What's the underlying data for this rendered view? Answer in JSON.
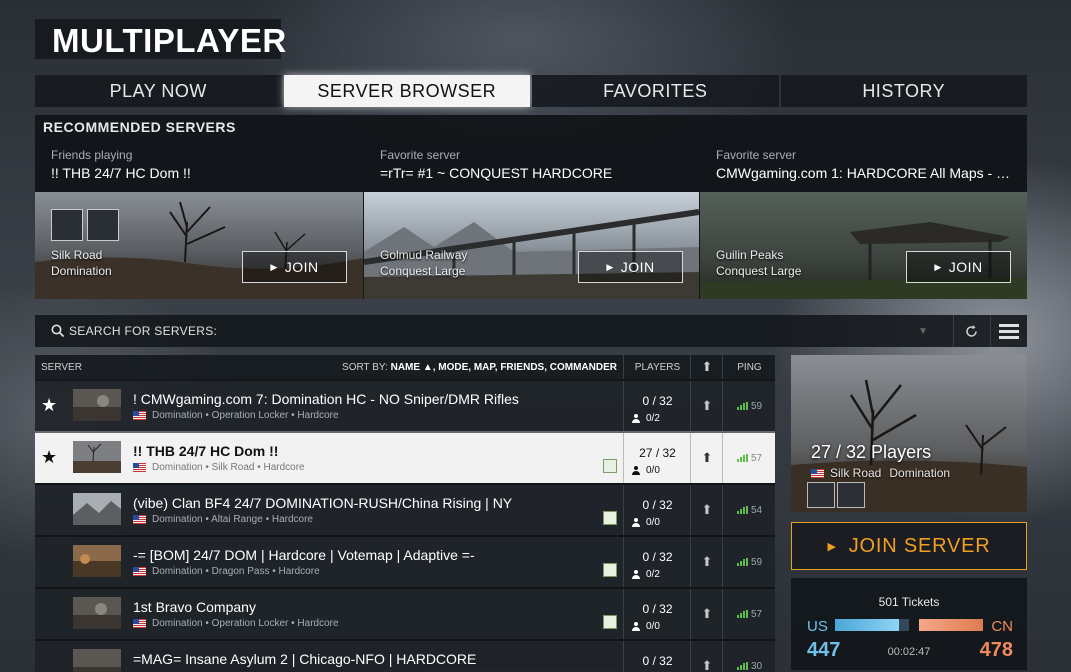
{
  "app": {
    "title": "MULTIPLAYER"
  },
  "tabs": [
    {
      "label": "PLAY NOW",
      "active": false
    },
    {
      "label": "SERVER BROWSER",
      "active": true
    },
    {
      "label": "FAVORITES",
      "active": false
    },
    {
      "label": "HISTORY",
      "active": false
    }
  ],
  "recommended": {
    "heading": "RECOMMENDED SERVERS",
    "cards": [
      {
        "kind": "Friends playing",
        "server": "!! THB 24/7 HC Dom !!",
        "map": "Silk Road",
        "mode": "Domination",
        "join": "JOIN"
      },
      {
        "kind": "Favorite server",
        "server": "=rTr= #1 ~ CONQUEST HARDCORE",
        "map": "Golmud Railway",
        "mode": "Conquest Large",
        "join": "JOIN"
      },
      {
        "kind": "Favorite server",
        "server": "CMWgaming.com 1: HARDCORE All Maps - …",
        "map": "Guilin Peaks",
        "mode": "Conquest Large",
        "join": "JOIN"
      }
    ]
  },
  "search": {
    "label": "SEARCH FOR SERVERS:",
    "icon": "search-icon",
    "refresh_icon": "refresh-icon",
    "menu_icon": "menu-icon"
  },
  "list": {
    "headers": {
      "server": "SERVER",
      "sort_prefix": "SORT BY:",
      "sort_name": "NAME ▲",
      "sort_rest": ", MODE, MAP, FRIENDS, COMMANDER",
      "players": "PLAYERS",
      "ping": "PING"
    },
    "rows": [
      {
        "star": "★",
        "name": "! CMWgaming.com 7: Domination HC - NO Sniper/DMR Rifles",
        "meta": "Domination • Operation Locker • Hardcore",
        "players": "0 / 32",
        "queue": "0/2",
        "ping": "59",
        "commander": false,
        "selected": false
      },
      {
        "star": "★",
        "name": "!! THB 24/7 HC Dom !!",
        "meta": "Domination • Silk Road • Hardcore",
        "players": "27 / 32",
        "queue": "0/0",
        "ping": "57",
        "commander": true,
        "selected": true
      },
      {
        "star": "",
        "name": "(vibe) Clan BF4 24/7 DOMINATION-RUSH/China Rising | NY",
        "meta": "Domination • Altai Range • Hardcore",
        "players": "0 / 32",
        "queue": "0/0",
        "ping": "54",
        "commander": true,
        "selected": false
      },
      {
        "star": "",
        "name": "-= [BOM] 24/7 DOM | Hardcore | Votemap | Adaptive =-",
        "meta": "Domination • Dragon Pass • Hardcore",
        "players": "0 / 32",
        "queue": "0/2",
        "ping": "59",
        "commander": true,
        "selected": false
      },
      {
        "star": "",
        "name": "1st Bravo Company",
        "meta": "Domination • Operation Locker • Hardcore",
        "players": "0 / 32",
        "queue": "0/0",
        "ping": "57",
        "commander": true,
        "selected": false
      },
      {
        "star": "",
        "name": "=MAG= Insane Asylum 2 | Chicago-NFO | HARDCORE",
        "meta": "",
        "players": "0 / 32",
        "queue": "",
        "ping": "30",
        "commander": false,
        "selected": false
      }
    ]
  },
  "preview": {
    "players": "27 / 32 Players",
    "map": "Silk Road",
    "mode": "Domination"
  },
  "join_server": {
    "label": "JOIN SERVER"
  },
  "tickets": {
    "title": "501 Tickets",
    "team1": "US",
    "team2": "CN",
    "score1": "447",
    "score2": "478",
    "time": "00:02:47"
  },
  "colors": {
    "accent": "#f0a020",
    "team_us": "#6fc1ea",
    "team_cn": "#f08a5d",
    "ping_good": "#5cbf4a"
  }
}
